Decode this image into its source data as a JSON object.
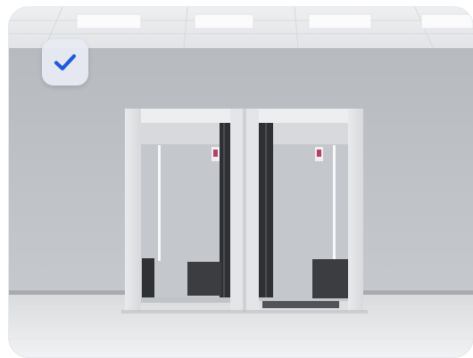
{
  "image": {
    "description_icon": "fitting-room-photo",
    "selected": true,
    "check_icon": "checkmark-icon",
    "check_color": "#1f5bd8"
  }
}
